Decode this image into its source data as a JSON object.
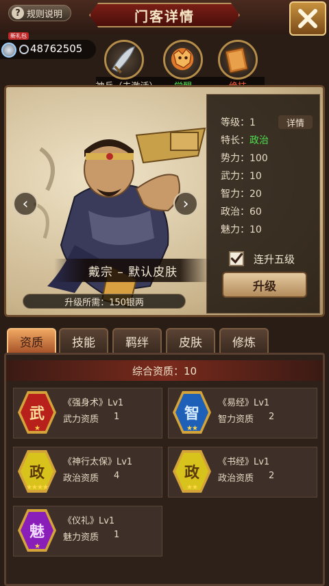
{
  "header": {
    "rules_label": "规则说明",
    "title": "门客详情",
    "close_icon": "close-icon"
  },
  "currency": {
    "gift_tag": "新礼包",
    "value": "48762505"
  },
  "equipment": [
    {
      "label": "神兵（未激活）",
      "color": "#e8dcc6",
      "icon": "blade-icon"
    },
    {
      "label": "觉醒",
      "color": "#4fe04f",
      "icon": "dragon-icon"
    },
    {
      "label": "绝技",
      "color": "#ff5a3a",
      "icon": "book-icon"
    }
  ],
  "hero": {
    "name": "戴宗 – 默认皮肤",
    "upgrade_cost": "升级所需：150银两"
  },
  "stats": {
    "detail_label": "详情",
    "level": "等级：1",
    "specialty_label": "特长：",
    "specialty_value": "政治",
    "power": "势力：100",
    "force": "武力：10",
    "intellect": "智力：20",
    "politics": "政治：60",
    "charm": "魅力：10",
    "auto_five": "连升五级",
    "auto_five_checked": true,
    "upgrade_label": "升级"
  },
  "tabs": [
    "资质",
    "技能",
    "羁绊",
    "皮肤",
    "修炼"
  ],
  "active_tab": 0,
  "aptitude": {
    "total": "综合资质：10"
  },
  "skills": [
    {
      "glyph": "武",
      "name": "《强身术》Lv1",
      "attr": "武力资质",
      "value": "1",
      "stars": "★",
      "bg": "#b8201c",
      "fg": "#ffdf9a"
    },
    {
      "glyph": "智",
      "name": "《易经》Lv1",
      "attr": "智力资质",
      "value": "2",
      "stars": "★★",
      "bg": "#1e5fb8",
      "fg": "#d8ecff"
    },
    {
      "glyph": "政",
      "name": "《神行太保》Lv1",
      "attr": "政治资质",
      "value": "4",
      "stars": "★★★★",
      "bg": "#d8c21c",
      "fg": "#5a3a08"
    },
    {
      "glyph": "政",
      "name": "《书经》Lv1",
      "attr": "政治资质",
      "value": "2",
      "stars": "★★",
      "bg": "#d8c21c",
      "fg": "#5a3a08"
    },
    {
      "glyph": "魅",
      "name": "《仪礼》Lv1",
      "attr": "魅力资质",
      "value": "1",
      "stars": "★",
      "bg": "#8a1eb8",
      "fg": "#f0d8ff"
    }
  ]
}
